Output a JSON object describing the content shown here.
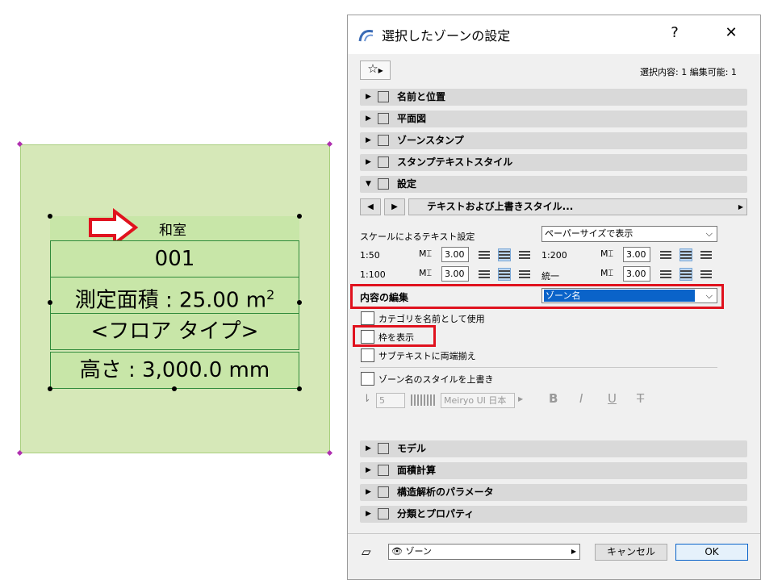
{
  "zone_stamp": {
    "name": "和室",
    "number": "001",
    "area": "測定面積 : 25.00 m",
    "area_sup": "2",
    "floor_type": "<フロア タイプ>",
    "height": "高さ : 3,000.0 mm"
  },
  "dialog": {
    "title": "選択したゾーンの設定",
    "help": "?",
    "close": "✕",
    "selection_info": "選択内容: 1 編集可能: 1",
    "panels_top": [
      {
        "label": "名前と位置",
        "arrow": "▶"
      },
      {
        "label": "平面図",
        "arrow": "▶"
      },
      {
        "label": "ゾーンスタンプ",
        "arrow": "▶"
      },
      {
        "label": "スタンプテキストスタイル",
        "arrow": "▶"
      },
      {
        "label": "設定",
        "arrow": "▼"
      }
    ],
    "nav": {
      "prev": "◀",
      "next": "▶",
      "label": "テキストおよび上書きスタイル...",
      "more": "▶"
    },
    "scale_text_label": "スケールによるテキスト設定",
    "scale_text_value": "ペーパーサイズで表示",
    "scales": [
      {
        "label": "1:50",
        "value": "3.00"
      },
      {
        "label": "1:200",
        "value": "3.00"
      },
      {
        "label": "1:100",
        "value": "3.00"
      },
      {
        "label": "統一",
        "value": "3.00"
      }
    ],
    "content_edit_label": "内容の編集",
    "content_edit_value": "ゾーン名",
    "checkboxes": [
      "カテゴリを名前として使用",
      "枠を表示",
      "サブテキストに両端揃え"
    ],
    "override_style": "ゾーン名のスタイルを上書き",
    "pen_value": "5",
    "font_value": "Meiryo UI 日本",
    "style_buttons": [
      "B",
      "I",
      "U",
      "T"
    ],
    "panels_bottom": [
      {
        "label": "モデル",
        "arrow": "▶"
      },
      {
        "label": "面積計算",
        "arrow": "▶"
      },
      {
        "label": "構造解析のパラメータ",
        "arrow": "▶"
      },
      {
        "label": "分類とプロパティ",
        "arrow": "▶"
      }
    ],
    "layer_value": "ゾーン",
    "cancel_label": "キャンセル",
    "ok_label": "OK"
  },
  "colors": {
    "accent_red": "#e0121e",
    "zone_fill": "#d6e8b8",
    "selection_blue": "#0a63c9"
  }
}
